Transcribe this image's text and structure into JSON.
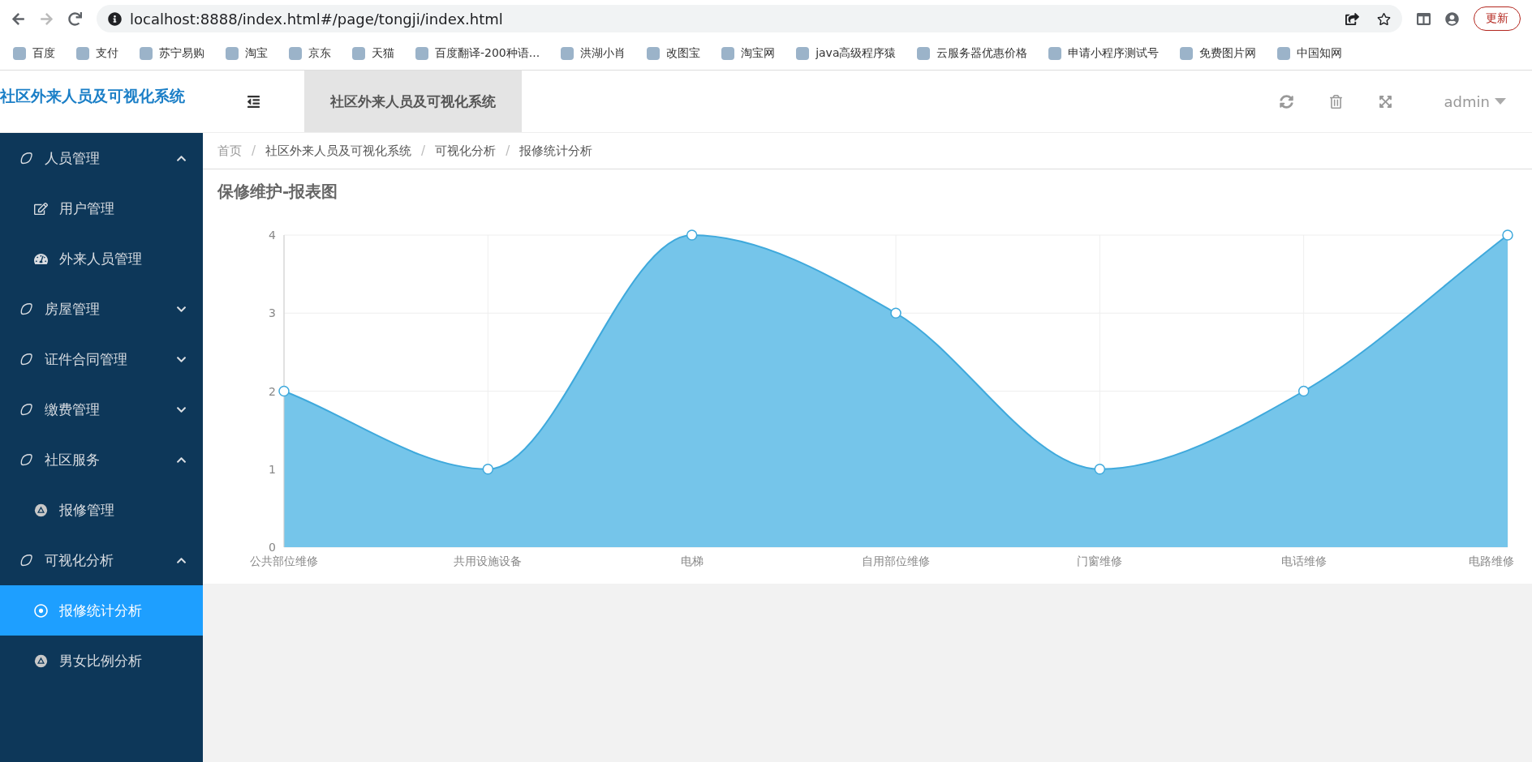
{
  "browser": {
    "url": "localhost:8888/index.html#/page/tongji/index.html",
    "update_button": "更新",
    "bookmarks": [
      "百度",
      "支付",
      "苏宁易购",
      "淘宝",
      "京东",
      "天猫",
      "百度翻译-200种语...",
      "洪湖小肖",
      "改图宝",
      "淘宝网",
      "java高级程序猿",
      "云服务器优惠价格",
      "申请小程序测试号",
      "免费图片网",
      "中国知网"
    ]
  },
  "header": {
    "logo": "社区外来人员及可视化系统",
    "tab": "社区外来人员及可视化系统",
    "user": "admin"
  },
  "sidebar": {
    "items": [
      {
        "label": "人员管理",
        "expanded": true,
        "children": [
          {
            "label": "用户管理",
            "selected": false
          },
          {
            "label": "外来人员管理",
            "selected": false
          }
        ]
      },
      {
        "label": "房屋管理",
        "expanded": false
      },
      {
        "label": "证件合同管理",
        "expanded": false
      },
      {
        "label": "缴费管理",
        "expanded": false
      },
      {
        "label": "社区服务",
        "expanded": true,
        "children": [
          {
            "label": "报修管理",
            "selected": false
          }
        ]
      },
      {
        "label": "可视化分析",
        "expanded": true,
        "children": [
          {
            "label": "报修统计分析",
            "selected": true
          },
          {
            "label": "男女比例分析",
            "selected": false
          }
        ]
      }
    ]
  },
  "breadcrumb": [
    {
      "label": "首页"
    },
    {
      "separator": "/",
      "label": "社区外来人员及可视化系统"
    },
    {
      "separator": "/",
      "label": "可视化分析"
    },
    {
      "separator": "/",
      "label": "报修统计分析"
    }
  ],
  "panel": {
    "title": "保修维护-报表图",
    "chart_data": {
      "type": "area",
      "categories": [
        "公共部位维修",
        "共用设施设备",
        "电梯",
        "自用部位维修",
        "门窗维修",
        "电话维修",
        "电路维修"
      ],
      "series": [
        {
          "color": "#3fa9dc",
          "values": [
            2,
            1,
            4,
            3,
            1,
            2,
            4
          ]
        }
      ],
      "ylim": [
        0,
        4
      ],
      "yticks": [
        0,
        1,
        2,
        3,
        4
      ],
      "grid": true
    }
  }
}
